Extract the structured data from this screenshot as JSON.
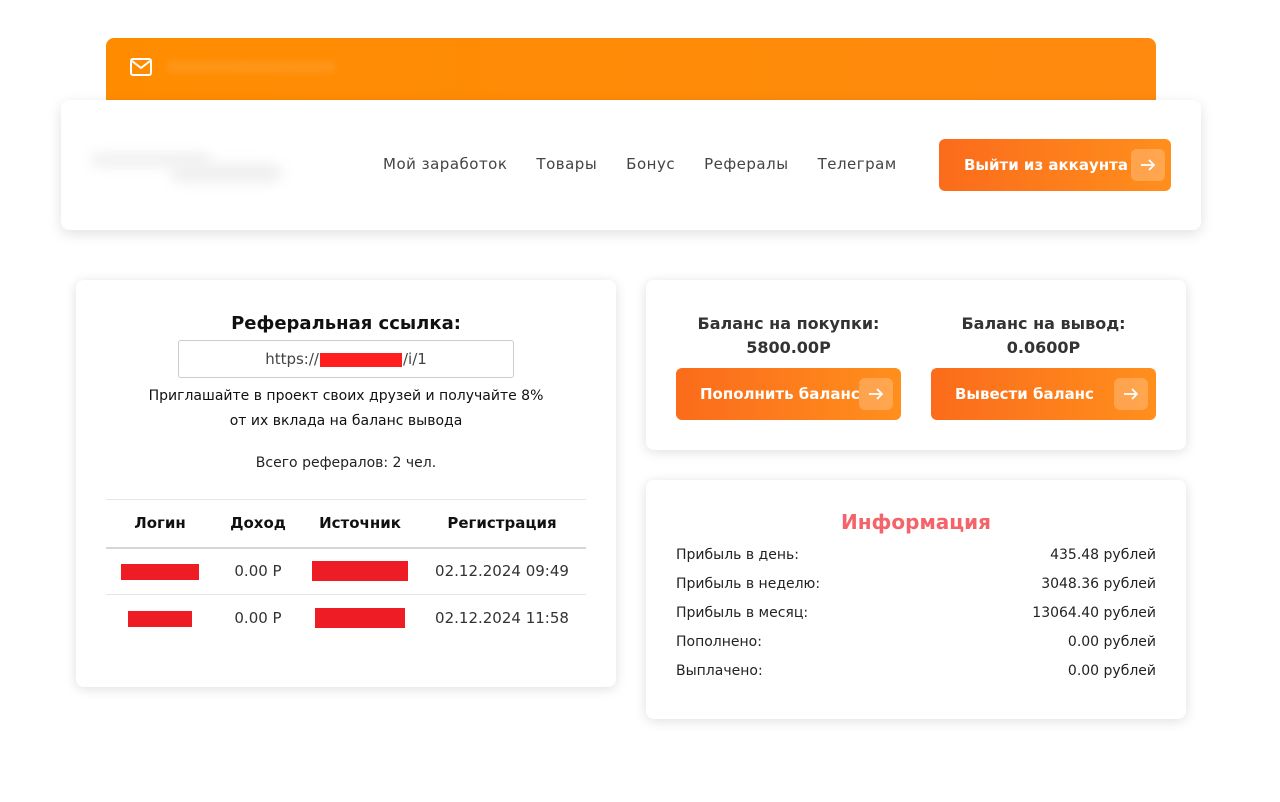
{
  "topbar": {
    "email_icon": "envelope-icon"
  },
  "nav": {
    "items": [
      "Мой заработок",
      "Товары",
      "Бонус",
      "Рефералы",
      "Телеграм"
    ],
    "logout_label": "Выйти из аккаунта"
  },
  "referral": {
    "title": "Реферальная ссылка:",
    "link_prefix": "https://",
    "link_suffix": "/i/1",
    "desc_line1": "Приглашайте в проект своих друзей и получайте 8%",
    "desc_line2": "от их вклада на баланс вывода",
    "total": "Всего рефералов: 2 чел.",
    "columns": [
      "Логин",
      "Доход",
      "Источник",
      "Регистрация"
    ],
    "rows": [
      {
        "income": "0.00 Р",
        "registered": "02.12.2024 09:49"
      },
      {
        "income": "0.00 Р",
        "registered": "02.12.2024 11:58"
      }
    ]
  },
  "balance": {
    "purchase_label": "Баланс на покупки:",
    "purchase_value": "5800.00Р",
    "withdraw_label": "Баланс на вывод:",
    "withdraw_value": "0.0600Р",
    "topup_button": "Пополнить баланс",
    "withdraw_button": "Вывести баланс"
  },
  "info": {
    "title": "Информация",
    "rows": [
      {
        "label": "Прибыль в день:",
        "value": "435.48 рублей"
      },
      {
        "label": "Прибыль в неделю:",
        "value": "3048.36 рублей"
      },
      {
        "label": "Прибыль в месяц:",
        "value": "13064.40 рублей"
      },
      {
        "label": "Пополнено:",
        "value": "0.00 рублей"
      },
      {
        "label": "Выплачено:",
        "value": "0.00 рублей"
      }
    ]
  },
  "colors": {
    "accent": "#ff8a0f",
    "button_start": "#fb6b1b",
    "button_end": "#ff8f1d",
    "info_title": "#f4636a",
    "redaction": "#ee1c25"
  }
}
